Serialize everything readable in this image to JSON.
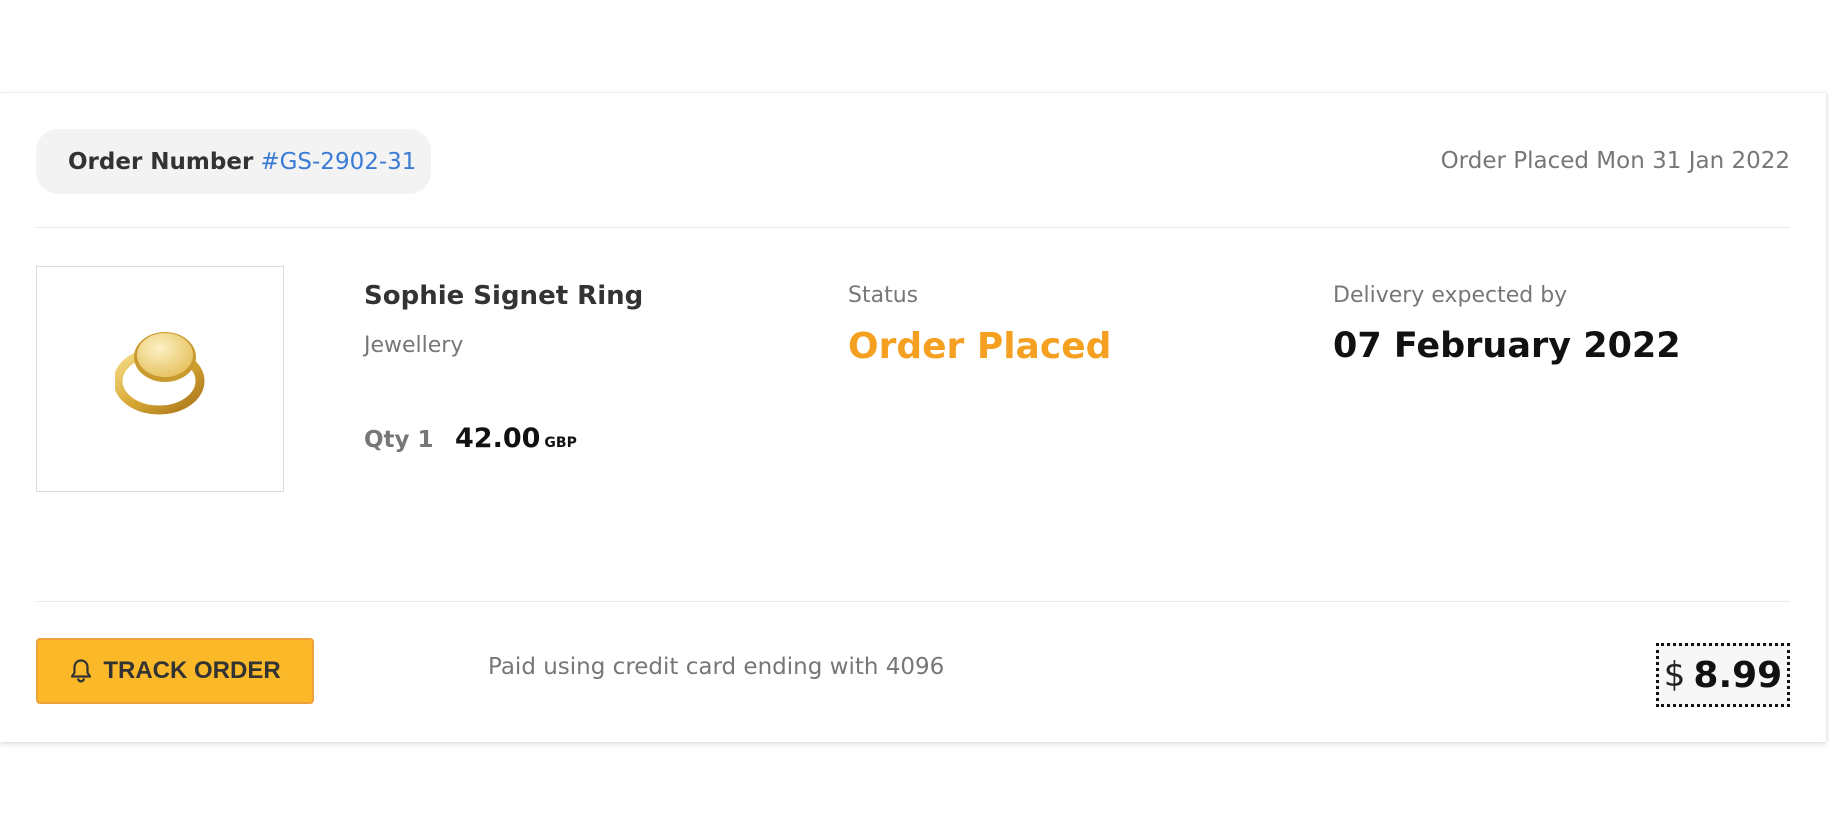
{
  "order": {
    "number_label": "Order Number",
    "number_value": "#GS-2902-31",
    "placed_text": "Order Placed Mon 31 Jan 2022"
  },
  "product": {
    "name": "Sophie Signet Ring",
    "category": "Jewellery",
    "qty_label": "Qty 1",
    "price": "42.00",
    "currency": "GBP",
    "image_icon": "gold-signet-ring"
  },
  "status": {
    "label": "Status",
    "value": "Order Placed",
    "color": "#f5a021"
  },
  "delivery": {
    "label": "Delivery expected by",
    "date": "07 February 2022"
  },
  "footer": {
    "track_button_label": "TRACK ORDER",
    "track_button_icon": "bell-icon",
    "track_button_color": "#fbb829",
    "payment_note": "Paid using credit card ending with 4096",
    "total_symbol": "$",
    "total_amount": "8.99"
  },
  "colors": {
    "accent_link": "#3a7bd5",
    "muted_text": "#777777"
  }
}
